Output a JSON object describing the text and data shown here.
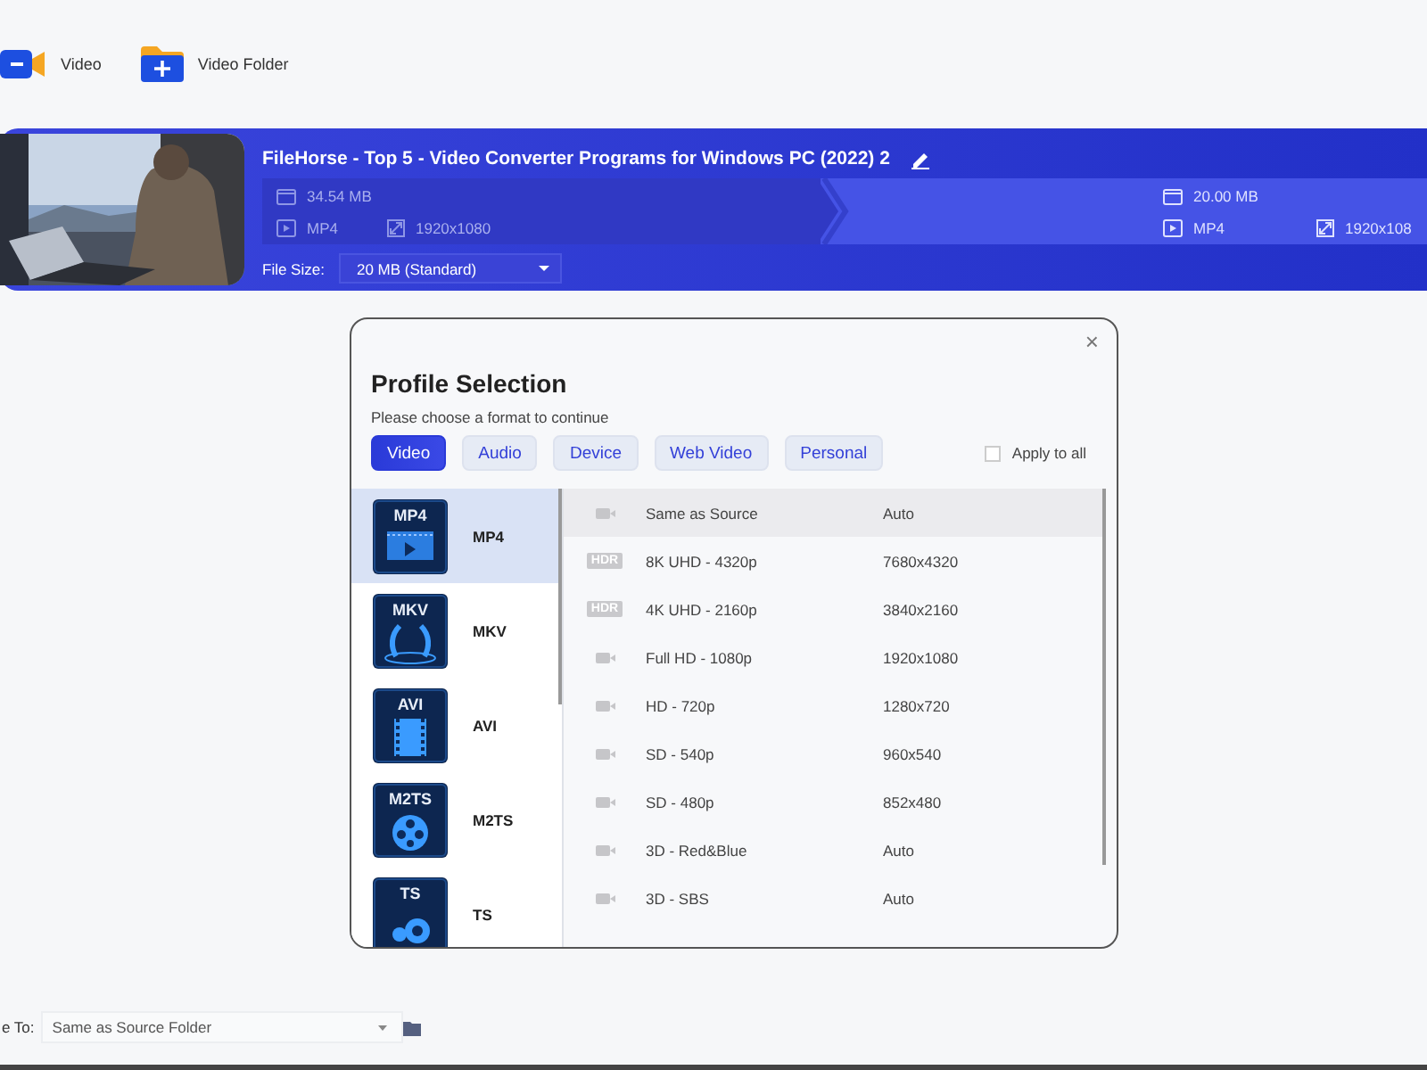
{
  "toolbar": [
    {
      "kind": "video",
      "label": "Video"
    },
    {
      "kind": "folder",
      "label": "Video Folder"
    }
  ],
  "video": {
    "title": "FileHorse - Top 5 - Video Converter Programs for Windows PC (2022) 2",
    "source": {
      "size": "34.54 MB",
      "format": "MP4",
      "resolution": "1920x1080"
    },
    "output": {
      "size": "20.00 MB",
      "format": "MP4",
      "resolution": "1920x108"
    },
    "file_size_label": "File Size:",
    "file_size": "20 MB (Standard)"
  },
  "dialog": {
    "close": "×",
    "title": "Profile Selection",
    "subtitle": "Please choose a format to continue",
    "tabs": [
      {
        "label": "Video",
        "selected": true
      },
      {
        "label": "Audio",
        "selected": false
      },
      {
        "label": "Device",
        "selected": false
      },
      {
        "label": "Web Video",
        "selected": false
      },
      {
        "label": "Personal",
        "selected": false
      }
    ],
    "apply_to_all": {
      "label": "Apply to all",
      "checked": false
    },
    "formats": [
      {
        "kind": "film",
        "icon_label": "MP4",
        "name": "MP4",
        "selected": true
      },
      {
        "kind": "arch",
        "icon_label": "MKV",
        "name": "MKV",
        "selected": false
      },
      {
        "kind": "strip",
        "icon_label": "AVI",
        "name": "AVI",
        "selected": false
      },
      {
        "kind": "reel",
        "icon_label": "M2TS",
        "name": "M2TS",
        "selected": false
      },
      {
        "kind": "dots",
        "icon_label": "TS",
        "name": "TS",
        "selected": false
      }
    ],
    "presets": [
      {
        "kind": "camera",
        "name": "Same as Source",
        "resolution": "Auto",
        "selected": true
      },
      {
        "kind": "hdr",
        "badge": "HDR",
        "name": "8K UHD - 4320p",
        "resolution": "7680x4320",
        "selected": false
      },
      {
        "kind": "hdr",
        "badge": "HDR",
        "name": "4K UHD - 2160p",
        "resolution": "3840x2160",
        "selected": false
      },
      {
        "kind": "camera",
        "name": "Full HD - 1080p",
        "resolution": "1920x1080",
        "selected": false
      },
      {
        "kind": "camera",
        "name": "HD - 720p",
        "resolution": "1280x720",
        "selected": false
      },
      {
        "kind": "camera",
        "name": "SD - 540p",
        "resolution": "960x540",
        "selected": false
      },
      {
        "kind": "camera",
        "name": "SD - 480p",
        "resolution": "852x480",
        "selected": false
      },
      {
        "kind": "camera",
        "name": "3D - Red&Blue",
        "resolution": "Auto",
        "selected": false
      },
      {
        "kind": "camera",
        "name": "3D - SBS",
        "resolution": "Auto",
        "selected": false
      }
    ]
  },
  "save_to": {
    "label": "e To:",
    "value": "Same as Source Folder"
  }
}
